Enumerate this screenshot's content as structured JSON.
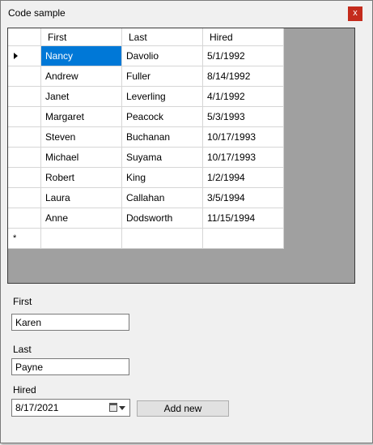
{
  "window": {
    "title": "Code sample",
    "close_glyph": "x"
  },
  "grid": {
    "columns": [
      "First",
      "Last",
      "Hired"
    ],
    "rows": [
      [
        "Nancy",
        "Davolio",
        "5/1/1992"
      ],
      [
        "Andrew",
        "Fuller",
        "8/14/1992"
      ],
      [
        "Janet",
        "Leverling",
        "4/1/1992"
      ],
      [
        "Margaret",
        "Peacock",
        "5/3/1993"
      ],
      [
        "Steven",
        "Buchanan",
        "10/17/1993"
      ],
      [
        "Michael",
        "Suyama",
        "10/17/1993"
      ],
      [
        "Robert",
        "King",
        "1/2/1994"
      ],
      [
        "Laura",
        "Callahan",
        "3/5/1994"
      ],
      [
        "Anne",
        "Dodsworth",
        "11/15/1994"
      ]
    ],
    "new_row_marker": "*",
    "current_row_icon": "triangle-right-icon",
    "selected_color": "#0078d7"
  },
  "form": {
    "first_label": "First",
    "first_value": "Karen",
    "last_label": "Last",
    "last_value": "Payne",
    "hired_label": "Hired",
    "hired_value": "8/17/2021",
    "add_label": "Add new"
  }
}
